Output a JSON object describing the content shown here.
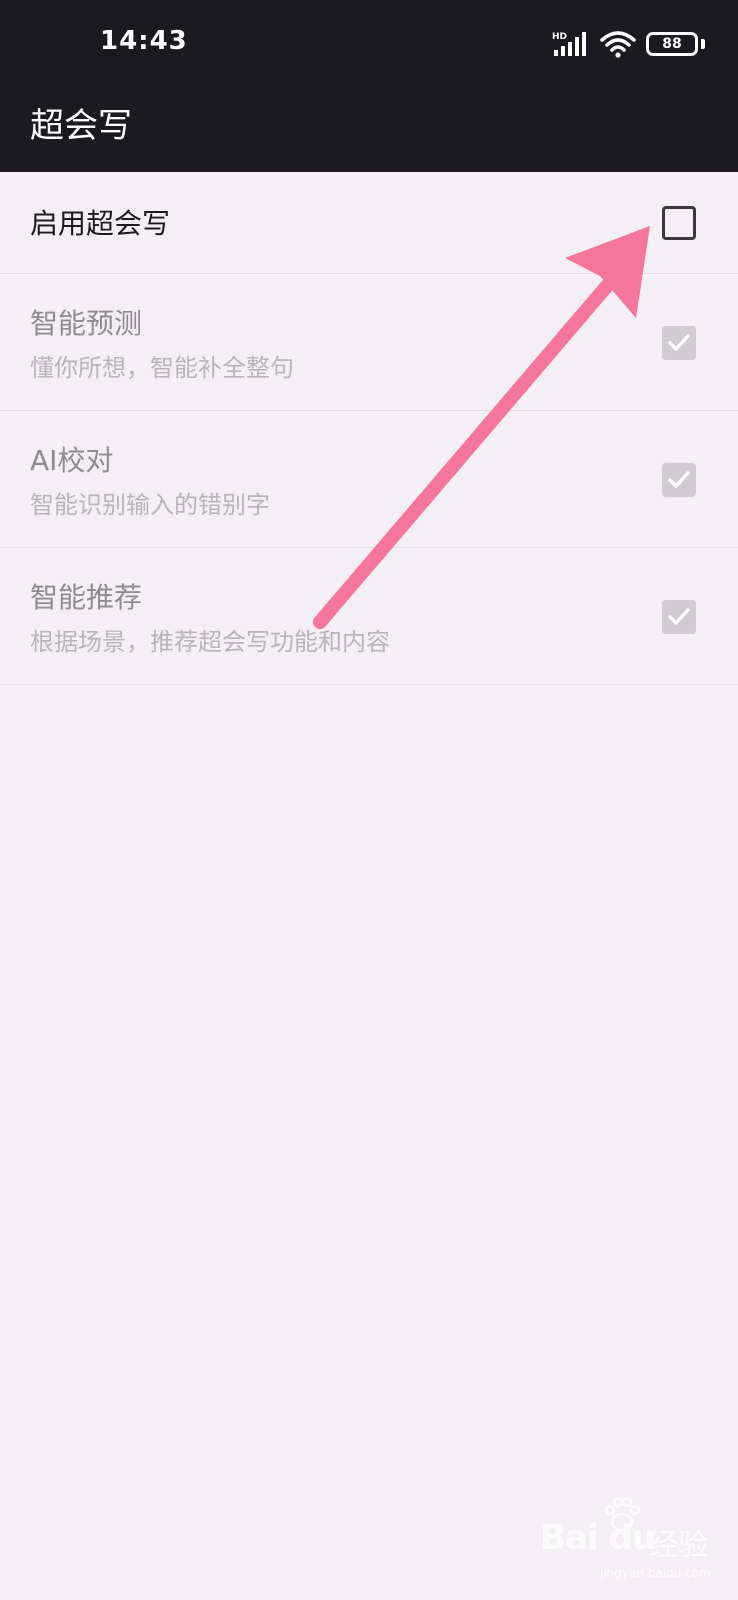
{
  "status_bar": {
    "time": "14:43",
    "network_label": "HD",
    "battery_level": "88"
  },
  "app_bar": {
    "title": "超会写"
  },
  "settings": [
    {
      "title": "启用超会写",
      "subtitle": "",
      "checked": false,
      "enabled": true
    },
    {
      "title": "智能预测",
      "subtitle": "懂你所想，智能补全整句",
      "checked": true,
      "enabled": false
    },
    {
      "title": "AI校对",
      "subtitle": "智能识别输入的错别字",
      "checked": true,
      "enabled": false
    },
    {
      "title": "智能推荐",
      "subtitle": "根据场景，推荐超会写功能和内容",
      "checked": true,
      "enabled": false
    }
  ],
  "annotation": {
    "arrow_color": "#f4769b"
  },
  "watermark": {
    "logo_text": "Bai du",
    "chinese_text": "经验",
    "url_text": "jingyan.baidu.com"
  },
  "colors": {
    "app_bar_bg": "#1b1a1f",
    "page_bg": "#f4eff5",
    "disabled_check": "#cfcbd1"
  }
}
